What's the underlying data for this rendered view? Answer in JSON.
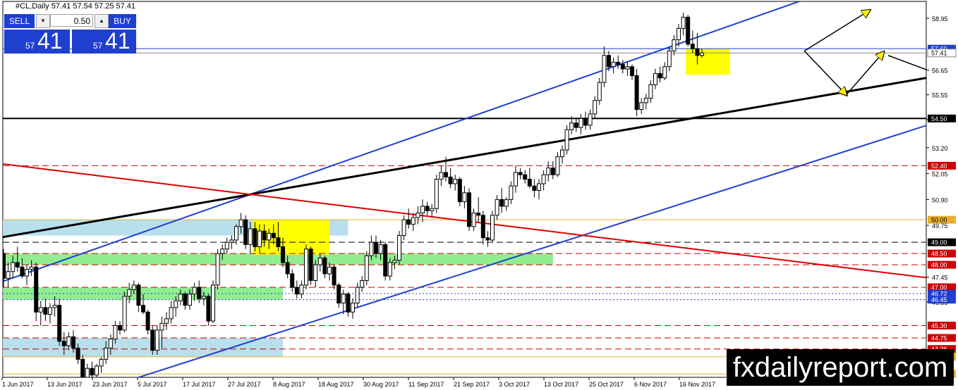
{
  "header": {
    "symbol_line": "#CL,Daily  57.41 57.54 57.25 57.41"
  },
  "trade_panel": {
    "sell_label": "SELL",
    "buy_label": "BUY",
    "lot_value": "0.50",
    "sell_price_small": "57",
    "sell_price_big": "41",
    "buy_price_small": "57",
    "buy_price_big": "41"
  },
  "watermark": "fxdailyreport.com",
  "chart_data": {
    "type": "candlestick",
    "x_labels": [
      "1 Jun 2017",
      "13 Jun 2017",
      "23 Jun 2017",
      "5 Jul 2017",
      "17 Jul 2017",
      "27 Jul 2017",
      "8 Aug 2017",
      "18 Aug 2017",
      "30 Aug 2017",
      "11 Sep 2017",
      "21 Sep 2017",
      "3 Oct 2017",
      "13 Oct 2017",
      "25 Oct 2017",
      "6 Nov 2017",
      "16 Nov 2017"
    ],
    "y_ticks": [
      "58.95",
      "56.65",
      "55.55",
      "54.45",
      "53.20",
      "52.05",
      "50.90",
      "49.75",
      "47.45",
      "46.35"
    ],
    "ylim": [
      43.0,
      59.7
    ],
    "levels": [
      {
        "label": "57.60",
        "value": 57.6,
        "color": "#1f3fd0",
        "style": "solid"
      },
      {
        "label": "57.41",
        "value": 57.41,
        "color": "#888888",
        "style": "solid"
      },
      {
        "label": "54.50",
        "value": 54.5,
        "color": "#000000",
        "style": "solid"
      },
      {
        "label": "52.40",
        "value": 52.4,
        "color": "#cc0000",
        "style": "dashed"
      },
      {
        "label": "50.00",
        "value": 50.0,
        "color": "#e8b030",
        "style": "solid"
      },
      {
        "label": "49.00",
        "value": 49.0,
        "color": "#000000",
        "style": "dashed"
      },
      {
        "label": "48.50",
        "value": 48.5,
        "color": "#cc0000",
        "style": "dashed"
      },
      {
        "label": "48.00",
        "value": 48.0,
        "color": "#cc0000",
        "style": "dashed"
      },
      {
        "label": "47.00",
        "value": 47.0,
        "color": "#cc0000",
        "style": "dashed"
      },
      {
        "label": "46.72",
        "value": 46.72,
        "color": "#1f3fd0",
        "style": "dotted"
      },
      {
        "label": "46.45",
        "value": 46.45,
        "color": "#1f3fd0",
        "style": "dotted"
      },
      {
        "label": "45.30",
        "value": 45.3,
        "color": "#cc0000",
        "style": "dashed"
      },
      {
        "label": "44.75",
        "value": 44.75,
        "color": "#cc0000",
        "style": "dashed"
      },
      {
        "label": "44.26",
        "value": 44.26,
        "color": "#cc0000",
        "style": "dashed"
      },
      {
        "label": "43.91",
        "value": 43.91,
        "color": "#e8b030",
        "style": "solid"
      },
      {
        "label": "43.15",
        "value": 43.15,
        "color": "#e8b030",
        "style": "solid"
      }
    ],
    "zones": [
      {
        "x0": 0,
        "x1": 74,
        "y0": 49.3,
        "y1": 50.0,
        "color": "#b8e0ec"
      },
      {
        "x0": 0,
        "x1": 118,
        "y0": 48.0,
        "y1": 48.5,
        "color": "#90ee90"
      },
      {
        "x0": 0,
        "x1": 60,
        "y0": 46.45,
        "y1": 47.0,
        "color": "#90ee90"
      },
      {
        "x0": 0,
        "x1": 60,
        "y0": 43.91,
        "y1": 44.75,
        "color": "#b8e0ec"
      },
      {
        "x0": 54,
        "x1": 70,
        "y0": 48.45,
        "y1": 50.0,
        "color": "#ffff00"
      },
      {
        "x0": 147,
        "x1": 156,
        "y0": 56.45,
        "y1": 57.6,
        "color": "#ffff00"
      }
    ],
    "trendlines": [
      {
        "x": [
          -1,
          175
        ],
        "y": [
          47.2,
          60.0
        ],
        "color": "#1f3fd0",
        "width": 2
      },
      {
        "x": [
          26,
          215
        ],
        "y": [
          42.8,
          55.3
        ],
        "color": "#1f3fd0",
        "width": 2
      },
      {
        "x": [
          -1,
          215
        ],
        "y": [
          49.2,
          56.9
        ],
        "color": "#000000",
        "width": 3
      },
      {
        "x": [
          -1,
          215
        ],
        "y": [
          52.5,
          47.0
        ],
        "color": "#dd0000",
        "width": 2
      }
    ],
    "arrows": [
      {
        "x": [
          172,
          186
        ],
        "y": [
          57.5,
          59.3
        ],
        "color": "#000000"
      },
      {
        "x": [
          172,
          181
        ],
        "y": [
          57.5,
          55.55
        ],
        "color": "#000000"
      },
      {
        "x": [
          181,
          189
        ],
        "y": [
          55.55,
          57.45
        ],
        "color": "#000000"
      },
      {
        "x": [
          190,
          201
        ],
        "y": [
          57.3,
          56.45
        ],
        "color": "#000000"
      }
    ],
    "candles": [
      [
        48.5,
        48.7,
        47.0,
        47.4
      ],
      [
        47.4,
        48.1,
        47.0,
        47.7
      ],
      [
        47.7,
        48.4,
        47.4,
        48.1
      ],
      [
        48.1,
        48.8,
        47.7,
        47.9
      ],
      [
        47.9,
        48.3,
        47.4,
        47.5
      ],
      [
        47.5,
        48.0,
        47.1,
        47.8
      ],
      [
        47.8,
        48.2,
        47.5,
        47.9
      ],
      [
        47.9,
        48.1,
        45.5,
        45.9
      ],
      [
        45.9,
        46.4,
        45.3,
        46.1
      ],
      [
        46.1,
        46.5,
        45.5,
        45.8
      ],
      [
        45.8,
        46.3,
        45.4,
        46.1
      ],
      [
        46.1,
        46.6,
        45.7,
        46.2
      ],
      [
        46.2,
        46.5,
        44.4,
        44.6
      ],
      [
        44.6,
        45.0,
        44.0,
        44.4
      ],
      [
        44.4,
        45.0,
        44.2,
        44.8
      ],
      [
        44.8,
        45.1,
        44.1,
        44.3
      ],
      [
        44.3,
        44.5,
        43.6,
        43.8
      ],
      [
        43.8,
        44.0,
        42.8,
        43.0
      ],
      [
        43.0,
        43.6,
        42.7,
        43.4
      ],
      [
        43.4,
        43.7,
        42.9,
        43.1
      ],
      [
        43.1,
        43.6,
        42.9,
        43.5
      ],
      [
        43.5,
        43.9,
        43.2,
        43.8
      ],
      [
        43.8,
        44.6,
        43.6,
        44.3
      ],
      [
        44.3,
        44.9,
        44.0,
        44.7
      ],
      [
        44.7,
        45.5,
        44.5,
        45.3
      ],
      [
        45.3,
        45.5,
        44.9,
        45.1
      ],
      [
        45.1,
        46.8,
        45.0,
        46.6
      ],
      [
        46.6,
        47.2,
        46.3,
        46.9
      ],
      [
        46.9,
        47.3,
        46.7,
        47.1
      ],
      [
        47.1,
        47.2,
        45.9,
        46.2
      ],
      [
        46.2,
        46.7,
        45.8,
        45.9
      ],
      [
        45.9,
        46.0,
        44.9,
        45.1
      ],
      [
        45.1,
        45.3,
        44.0,
        44.2
      ],
      [
        44.2,
        45.3,
        44.0,
        45.1
      ],
      [
        45.1,
        45.7,
        44.3,
        45.4
      ],
      [
        45.4,
        45.9,
        45.1,
        45.6
      ],
      [
        45.6,
        46.4,
        45.4,
        46.1
      ],
      [
        46.1,
        46.6,
        45.7,
        46.4
      ],
      [
        46.4,
        46.9,
        46.2,
        46.7
      ],
      [
        46.7,
        46.8,
        46.0,
        46.2
      ],
      [
        46.2,
        46.9,
        46.0,
        46.7
      ],
      [
        46.7,
        47.2,
        46.4,
        47.0
      ],
      [
        47.0,
        47.3,
        46.3,
        46.5
      ],
      [
        46.5,
        46.8,
        46.2,
        46.6
      ],
      [
        46.6,
        46.7,
        45.3,
        45.5
      ],
      [
        45.5,
        47.3,
        45.4,
        47.1
      ],
      [
        47.1,
        48.7,
        46.9,
        48.5
      ],
      [
        48.5,
        48.9,
        48.2,
        48.7
      ],
      [
        48.7,
        49.2,
        48.5,
        49.0
      ],
      [
        49.0,
        49.3,
        48.7,
        49.1
      ],
      [
        49.1,
        49.8,
        48.9,
        49.7
      ],
      [
        49.7,
        50.3,
        49.4,
        50.0
      ],
      [
        50.0,
        50.2,
        48.7,
        48.9
      ],
      [
        48.9,
        49.9,
        48.5,
        49.6
      ],
      [
        49.6,
        49.9,
        48.6,
        48.8
      ],
      [
        48.8,
        49.8,
        48.5,
        49.5
      ],
      [
        49.5,
        49.8,
        48.8,
        49.1
      ],
      [
        49.1,
        49.6,
        48.7,
        49.4
      ],
      [
        49.4,
        49.8,
        48.9,
        49.2
      ],
      [
        49.2,
        49.9,
        48.6,
        48.8
      ],
      [
        48.8,
        49.2,
        47.9,
        48.1
      ],
      [
        48.1,
        48.4,
        47.4,
        47.6
      ],
      [
        47.6,
        47.8,
        46.8,
        47.0
      ],
      [
        47.0,
        47.3,
        46.5,
        46.7
      ],
      [
        46.7,
        47.3,
        46.5,
        47.1
      ],
      [
        47.1,
        48.9,
        46.9,
        48.7
      ],
      [
        48.7,
        48.8,
        47.1,
        47.3
      ],
      [
        47.3,
        48.2,
        47.0,
        48.0
      ],
      [
        48.0,
        48.5,
        47.7,
        48.3
      ],
      [
        48.3,
        48.4,
        47.4,
        47.6
      ],
      [
        47.6,
        48.1,
        47.3,
        47.9
      ],
      [
        47.9,
        48.0,
        46.9,
        47.1
      ],
      [
        47.1,
        47.2,
        46.1,
        46.3
      ],
      [
        46.3,
        46.9,
        45.8,
        46.7
      ],
      [
        46.7,
        46.8,
        45.7,
        45.9
      ],
      [
        45.9,
        46.5,
        45.6,
        46.3
      ],
      [
        46.3,
        47.2,
        46.1,
        47.0
      ],
      [
        47.0,
        47.5,
        46.8,
        47.3
      ],
      [
        47.3,
        48.6,
        47.1,
        48.4
      ],
      [
        48.4,
        49.3,
        48.2,
        49.0
      ],
      [
        49.0,
        49.3,
        48.3,
        48.5
      ],
      [
        48.5,
        49.1,
        48.2,
        48.9
      ],
      [
        48.9,
        49.0,
        47.3,
        47.5
      ],
      [
        47.5,
        48.3,
        47.3,
        48.1
      ],
      [
        48.1,
        48.4,
        47.8,
        48.2
      ],
      [
        48.2,
        49.5,
        48.0,
        49.3
      ],
      [
        49.3,
        50.2,
        49.1,
        50.0
      ],
      [
        50.0,
        50.5,
        49.6,
        49.8
      ],
      [
        49.8,
        50.3,
        49.5,
        50.1
      ],
      [
        50.1,
        50.6,
        49.8,
        50.3
      ],
      [
        50.3,
        50.9,
        49.9,
        50.6
      ],
      [
        50.6,
        50.8,
        50.2,
        50.4
      ],
      [
        50.4,
        50.7,
        50.1,
        50.5
      ],
      [
        50.5,
        52.0,
        50.3,
        51.8
      ],
      [
        51.8,
        52.4,
        51.5,
        52.1
      ],
      [
        52.1,
        52.8,
        51.7,
        51.9
      ],
      [
        51.9,
        52.3,
        51.4,
        51.6
      ],
      [
        51.6,
        52.0,
        51.3,
        51.8
      ],
      [
        51.8,
        51.9,
        50.6,
        50.8
      ],
      [
        50.8,
        51.5,
        50.5,
        51.2
      ],
      [
        51.2,
        51.4,
        49.5,
        49.7
      ],
      [
        49.7,
        50.5,
        49.5,
        50.3
      ],
      [
        50.3,
        51.0,
        49.9,
        50.2
      ],
      [
        50.2,
        50.4,
        48.9,
        49.2
      ],
      [
        49.2,
        49.5,
        48.8,
        49.1
      ],
      [
        49.1,
        50.4,
        49.0,
        50.2
      ],
      [
        50.2,
        51.1,
        50.0,
        50.9
      ],
      [
        50.9,
        51.4,
        50.3,
        50.6
      ],
      [
        50.6,
        51.0,
        50.4,
        50.9
      ],
      [
        50.9,
        51.7,
        50.7,
        51.5
      ],
      [
        51.5,
        52.4,
        51.2,
        52.1
      ],
      [
        52.1,
        52.3,
        51.8,
        52.0
      ],
      [
        52.0,
        52.2,
        51.6,
        51.8
      ],
      [
        51.8,
        52.3,
        51.4,
        51.5
      ],
      [
        51.5,
        51.8,
        51.0,
        51.3
      ],
      [
        51.3,
        51.8,
        50.9,
        51.6
      ],
      [
        51.6,
        52.2,
        51.3,
        52.0
      ],
      [
        52.0,
        52.6,
        51.7,
        52.3
      ],
      [
        52.3,
        52.6,
        51.8,
        52.0
      ],
      [
        52.0,
        53.0,
        51.9,
        52.8
      ],
      [
        52.8,
        53.3,
        52.5,
        53.1
      ],
      [
        53.1,
        54.2,
        52.9,
        54.0
      ],
      [
        54.0,
        54.6,
        53.8,
        54.3
      ],
      [
        54.3,
        54.5,
        53.9,
        54.1
      ],
      [
        54.1,
        54.7,
        53.8,
        54.5
      ],
      [
        54.5,
        54.8,
        54.0,
        54.2
      ],
      [
        54.2,
        54.9,
        54.0,
        54.7
      ],
      [
        54.7,
        55.5,
        54.5,
        55.3
      ],
      [
        55.3,
        56.3,
        55.1,
        56.1
      ],
      [
        56.1,
        57.7,
        55.9,
        57.3
      ],
      [
        57.3,
        57.5,
        56.6,
        56.8
      ],
      [
        56.8,
        57.2,
        56.5,
        57.0
      ],
      [
        57.0,
        57.3,
        56.7,
        56.9
      ],
      [
        56.9,
        57.1,
        56.5,
        56.7
      ],
      [
        56.7,
        57.0,
        56.4,
        56.8
      ],
      [
        56.8,
        56.9,
        56.2,
        56.4
      ],
      [
        56.4,
        56.7,
        54.6,
        54.9
      ],
      [
        54.9,
        55.4,
        54.7,
        55.2
      ],
      [
        55.2,
        55.6,
        54.9,
        55.4
      ],
      [
        55.4,
        56.2,
        55.2,
        56.0
      ],
      [
        56.0,
        56.7,
        55.8,
        56.5
      ],
      [
        56.5,
        56.8,
        56.1,
        56.3
      ],
      [
        56.3,
        57.0,
        56.2,
        56.8
      ],
      [
        56.8,
        57.7,
        56.6,
        57.5
      ],
      [
        57.5,
        58.2,
        57.3,
        58.0
      ],
      [
        58.0,
        58.7,
        57.7,
        58.5
      ],
      [
        58.5,
        59.2,
        58.2,
        59.0
      ],
      [
        59.0,
        59.1,
        57.7,
        57.8
      ],
      [
        57.8,
        58.4,
        57.4,
        57.6
      ],
      [
        57.6,
        58.3,
        56.9,
        57.3
      ],
      [
        57.3,
        57.6,
        57.2,
        57.41
      ]
    ]
  }
}
